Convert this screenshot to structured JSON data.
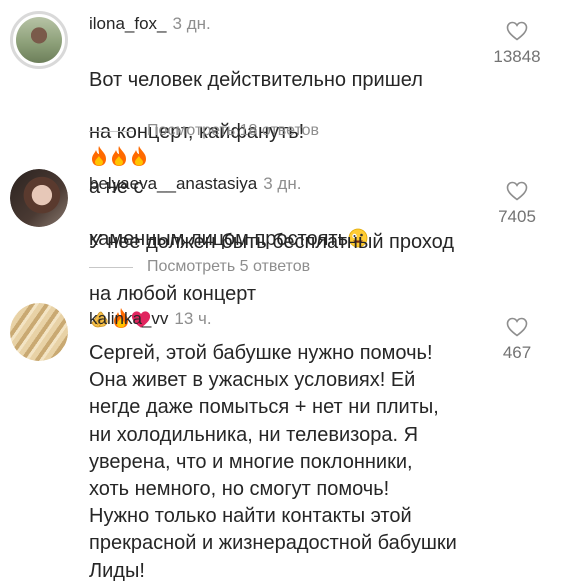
{
  "comments": [
    {
      "username": "ilona_fox_",
      "time": "3 дн.",
      "text_lines": [
        "Вот человек действительно пришел",
        "на концерт, кайфануть!",
        "а не с",
        "каменным лицом простоять"
      ],
      "emojis_line2": [
        "fire",
        "fire",
        "fire"
      ],
      "emoji_line4": "crazy-face",
      "replies_label": "Посмотреть 18 ответов",
      "likes": "13848",
      "avatar_icon": "woman-in-field-avatar"
    },
    {
      "username": "belyaeva__anastasiya",
      "time": "3 дн.",
      "text_lines": [
        "У нее должен быть бесплатный проход",
        "на любой концерт"
      ],
      "emojis_line2": [
        "clapping-hands",
        "fire",
        "red-heart"
      ],
      "replies_label": "Посмотреть 5 ответов",
      "likes": "7405",
      "avatar_icon": "woman-portrait-avatar"
    },
    {
      "username": "kalinka_vv",
      "time": "13 ч.",
      "text": "Сергей, этой бабушке нужно помочь!\nОна живет в ужасных условиях! Ей\nнегде даже помыться + нет ни плиты,\nни холодильника, ни телевизора. Я\nуверена, что и многие поклонники,\nхоть немного, но смогут помочь!\nНужно только найти контакты этой\nпрекрасной и жизнерадостной бабушки\nЛиды!",
      "likes": "467",
      "avatar_icon": "blonde-braid-avatar"
    }
  ],
  "colors": {
    "text": "#262626",
    "secondary": "#8e8e8e",
    "fire": "#ff6a00",
    "heart": "#e0245e"
  }
}
